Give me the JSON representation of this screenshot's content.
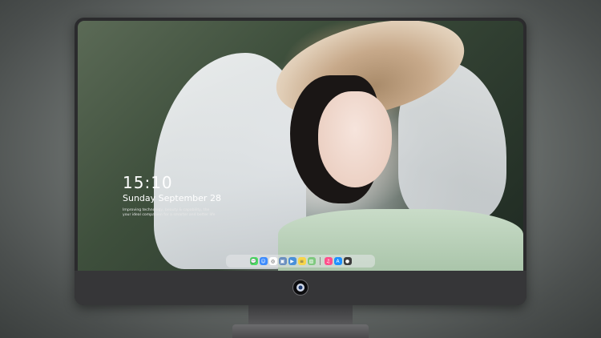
{
  "lock_screen": {
    "time": "15:10",
    "date": "Sunday September 28",
    "tagline_line1": "Improving technology, beauty & capability, the",
    "tagline_line2": "your ideal companion for a smarter and better life"
  },
  "dock": {
    "items": [
      {
        "name": "messages",
        "color": "#4cd964",
        "glyph": "💬"
      },
      {
        "name": "finder",
        "color": "#3d8bfd",
        "glyph": "☺"
      },
      {
        "name": "safari",
        "color": "#ffffff",
        "glyph": "◎"
      },
      {
        "name": "preview",
        "color": "#6b8fbf",
        "glyph": "▣"
      },
      {
        "name": "clapper",
        "color": "#4a90d9",
        "glyph": "🎬"
      },
      {
        "name": "notes",
        "color": "#f7d54a",
        "glyph": "≡"
      },
      {
        "name": "photos",
        "color": "#7fc97f",
        "glyph": "▧"
      },
      {
        "name": "music",
        "color": "#ff4f8b",
        "glyph": "♫"
      },
      {
        "name": "app-store",
        "color": "#1e90ff",
        "glyph": "A"
      },
      {
        "name": "camera",
        "color": "#3c3c3c",
        "glyph": "●"
      }
    ]
  },
  "colors": {
    "monitor_frame": "#2b2b2d",
    "chin": "#363638",
    "text": "#ffffff"
  }
}
